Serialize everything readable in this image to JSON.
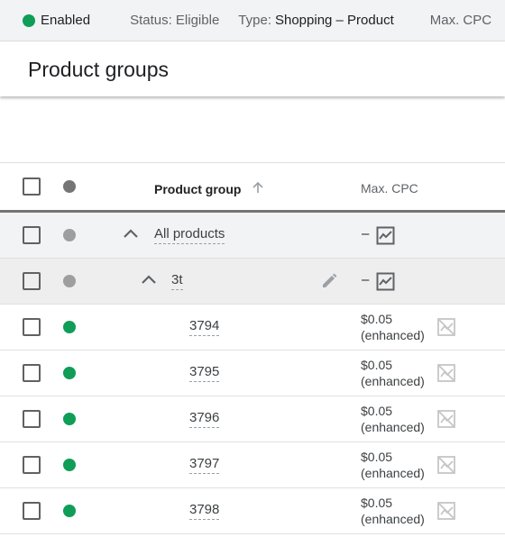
{
  "colors": {
    "enabled_green": "#0f9d58",
    "header_dot": "#757575",
    "inherit_dot": "#9e9e9e"
  },
  "status_bar": {
    "enabled_label": "Enabled",
    "status_text": "Status: Eligible",
    "type_label": "Type:",
    "type_value": "Shopping – Product",
    "max_cpc_label": "Max. CPC"
  },
  "page": {
    "title": "Product groups"
  },
  "table": {
    "columns": {
      "product_group": "Product group",
      "max_cpc": "Max. CPC"
    },
    "all_products": {
      "name": "All products",
      "bid": "–"
    },
    "group": {
      "name": "3t",
      "bid": "–"
    },
    "rows": [
      {
        "name": "3794",
        "bid": "$0.05",
        "bid_note": "(enhanced)"
      },
      {
        "name": "3795",
        "bid": "$0.05",
        "bid_note": "(enhanced)"
      },
      {
        "name": "3796",
        "bid": "$0.05",
        "bid_note": "(enhanced)"
      },
      {
        "name": "3797",
        "bid": "$0.05",
        "bid_note": "(enhanced)"
      },
      {
        "name": "3798",
        "bid": "$0.05",
        "bid_note": "(enhanced)"
      }
    ]
  }
}
